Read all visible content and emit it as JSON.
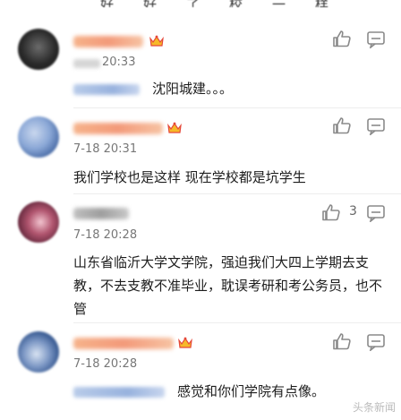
{
  "top_cut_text": "……好……好……了……校……一……样",
  "comments": [
    {
      "time": "20:33",
      "text": "沈阳城建。。。",
      "like_count": ""
    },
    {
      "time": "7-18 20:31",
      "text": "我们学校也是这样 现在学校都是坑学生",
      "like_count": ""
    },
    {
      "time": "7-18 20:28",
      "text": "山东省临沂大学文学院，强迫我们大四上学期去支教，不去支教不准毕业，耽误考研和考公务员，也不管",
      "like_count": "3"
    },
    {
      "time": "7-18 20:28",
      "text": "感觉和你们学院有点像。",
      "like_count": ""
    }
  ],
  "icons": {
    "like": "thumb-up-icon",
    "more": "message-square-icon",
    "vip": "crown-icon"
  },
  "colors": {
    "text": "#1d1d1d",
    "time": "#777777",
    "icon": "#8a8a8a",
    "crown_red": "#e5483a",
    "crown_gold": "#f6b928"
  },
  "watermark": "头条新闻"
}
